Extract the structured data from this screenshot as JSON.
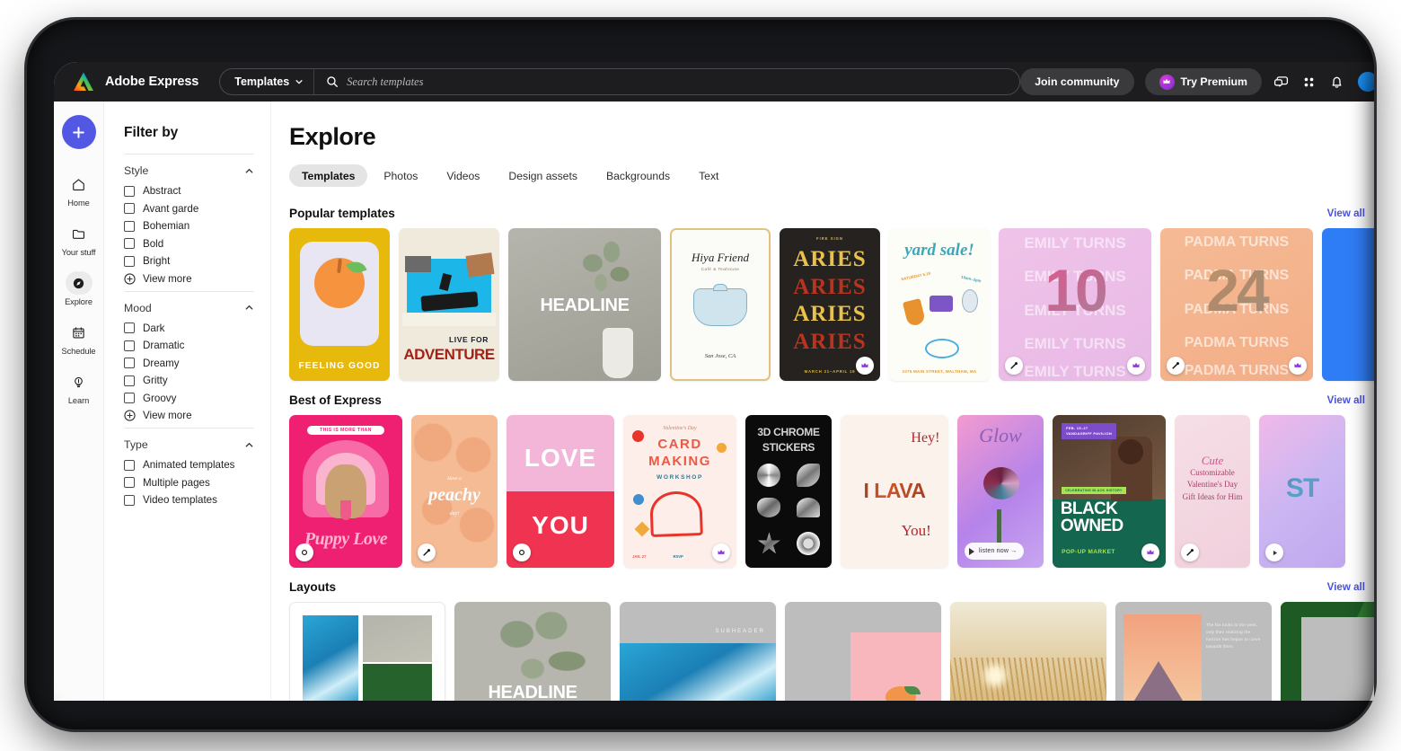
{
  "app": {
    "brand": "Adobe Express",
    "logo_icon": "adobe-express-logo"
  },
  "topbar": {
    "scope": "Templates",
    "scope_chevron_icon": "chevron-down-icon",
    "search_icon": "search-icon",
    "search_value": "",
    "search_placeholder": "Search templates",
    "join_community": "Join community",
    "try_premium": "Try Premium",
    "crown_icon": "crown-icon",
    "icons": [
      "feedback-chat-icon",
      "apps-grid-icon",
      "notifications-bell-icon"
    ],
    "avatar": "user-avatar"
  },
  "rail": {
    "new_button_icon": "plus-icon",
    "items": [
      {
        "label": "Home",
        "icon": "home-icon",
        "active": false
      },
      {
        "label": "Your stuff",
        "icon": "folder-icon",
        "active": false
      },
      {
        "label": "Explore",
        "icon": "compass-icon",
        "active": true
      },
      {
        "label": "Schedule",
        "icon": "calendar-icon",
        "active": false
      },
      {
        "label": "Learn",
        "icon": "lightbulb-icon",
        "active": false
      }
    ]
  },
  "filters": {
    "title": "Filter by",
    "collapse_icon": "chevron-up-icon",
    "view_more_icon": "plus-circle-icon",
    "view_more_label": "View more",
    "groups": [
      {
        "name": "Style",
        "options": [
          "Abstract",
          "Avant garde",
          "Bohemian",
          "Bold",
          "Bright"
        ],
        "has_view_more": true
      },
      {
        "name": "Mood",
        "options": [
          "Dark",
          "Dramatic",
          "Dreamy",
          "Gritty",
          "Groovy"
        ],
        "has_view_more": true
      },
      {
        "name": "Type",
        "options": [
          "Animated templates",
          "Multiple pages",
          "Video templates"
        ],
        "has_view_more": false
      }
    ]
  },
  "main": {
    "page_title": "Explore",
    "tabs": [
      {
        "label": "Templates",
        "active": true
      },
      {
        "label": "Photos",
        "active": false
      },
      {
        "label": "Videos",
        "active": false
      },
      {
        "label": "Design assets",
        "active": false
      },
      {
        "label": "Backgrounds",
        "active": false
      },
      {
        "label": "Text",
        "active": false
      }
    ],
    "view_all_label": "View all",
    "sections": [
      {
        "title": "Popular templates",
        "cards": [
          {
            "name": "feeling-good",
            "text": "FEELING GOOD"
          },
          {
            "name": "live-for-adventure",
            "kicker": "LIVE FOR",
            "text": "ADVENTURE"
          },
          {
            "name": "headline-plant",
            "text": "HEADLINE"
          },
          {
            "name": "hiya-friend",
            "text": "Hiya Friend",
            "sub": "Café & Teahouse",
            "footer": "San Jose, CA"
          },
          {
            "name": "aries-zodiac",
            "top": "FIRE SIGN",
            "text": "ARIES",
            "footer": "MARCH 21–APRIL 19",
            "premium": true
          },
          {
            "name": "yard-sale",
            "text": "yard sale!",
            "date": "SATURDAY 5.19",
            "time": "10am–3pm",
            "footer": "1075 MAIN STREET, WALTHAM, MA"
          },
          {
            "name": "emily-turns-10",
            "text": "EMILY TURNS",
            "number": "10",
            "animated": true,
            "premium": true
          },
          {
            "name": "padma-turns-24",
            "text": "PADMA TURNS",
            "number": "24",
            "animated": true,
            "premium": true
          },
          {
            "name": "blue-card",
            "text": ""
          }
        ]
      },
      {
        "title": "Best of Express",
        "cards": [
          {
            "name": "puppy-love",
            "kicker": "THIS IS MORE THAN",
            "text": "Puppy Love",
            "animated": true
          },
          {
            "name": "have-a-peachy-day",
            "kicker": "Have a",
            "text": "peachy",
            "sub": "day!",
            "animated": true
          },
          {
            "name": "love-you",
            "text": "LOVE",
            "text2": "YOU",
            "animated": true
          },
          {
            "name": "card-making-workshop",
            "kicker": "Valentine's Day",
            "text": "CARD MAKING",
            "sub": "WORKSHOP",
            "footer": "JAN. 27",
            "footer2": "RSVP",
            "premium": true
          },
          {
            "name": "3d-chrome-stickers",
            "text": "3D CHROME",
            "text2": "STICKERS"
          },
          {
            "name": "i-lava-you",
            "kicker": "Hey!",
            "text": "I LAVA",
            "sub": "You!"
          },
          {
            "name": "glow",
            "text": "Glow",
            "cta": "listen now →"
          },
          {
            "name": "black-owned-popup-market",
            "kicker": "FEB. 15–27",
            "kicker2": "VANDAGRIFF PAVILION",
            "tag": "CELEBRATING BLACK HISTORY",
            "text": "BLACK OWNED",
            "sub": "POP-UP MARKET",
            "premium": true
          },
          {
            "name": "cute-valentines-gift-ideas",
            "kicker": "Cute",
            "text": "Customizable Valentine's Day Gift Ideas for Him",
            "animated": true
          },
          {
            "name": "holographic-story",
            "text": "ST",
            "video": true
          }
        ]
      },
      {
        "title": "Layouts",
        "cards": [
          {
            "name": "layout-collage-grid"
          },
          {
            "name": "layout-headline-overlay",
            "text": "HEADLINE"
          },
          {
            "name": "layout-subheader-ocean",
            "text": "SUBHEADER"
          },
          {
            "name": "layout-peach-inset"
          },
          {
            "name": "layout-wheat-field"
          },
          {
            "name": "layout-mountain-text",
            "text": "The fox looks to the west, only then realizing the horizon has begun to curve towards them."
          },
          {
            "name": "layout-green-frame"
          }
        ]
      }
    ]
  },
  "colors": {
    "accent": "#5258e4",
    "link": "#4a53d8",
    "topbar_bg": "#1d1d1f",
    "premium": "#7a2bd6"
  }
}
